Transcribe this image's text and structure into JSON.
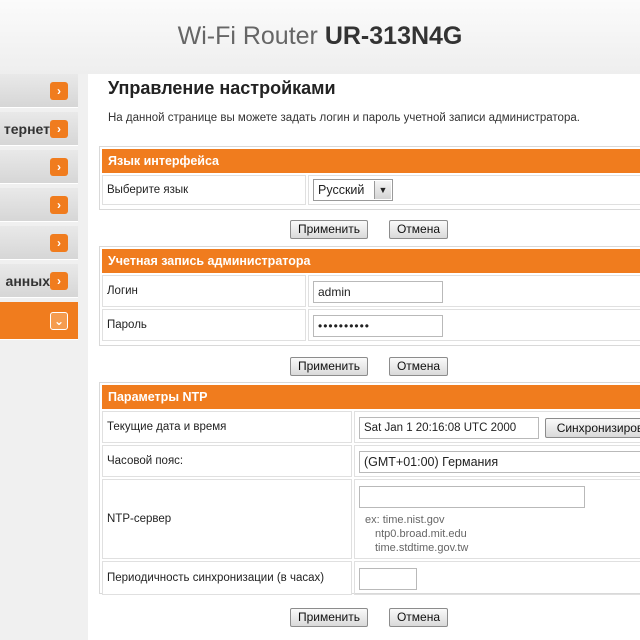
{
  "header": {
    "title_prefix": "Wi-Fi Router ",
    "model": "UR-313N4G"
  },
  "sidebar": {
    "items": [
      {
        "label": ""
      },
      {
        "label": "тернет"
      },
      {
        "label": ""
      },
      {
        "label": ""
      },
      {
        "label": ""
      },
      {
        "label": "анных"
      },
      {
        "label": ""
      }
    ]
  },
  "main": {
    "title": "Управление настройками",
    "description": "На данной странице вы можете задать логин и пароль учетной записи администратора."
  },
  "language_section": {
    "header": "Язык интерфейса",
    "select_label": "Выберите язык",
    "selected": "Русский"
  },
  "admin_section": {
    "header": "Учетная запись администратора",
    "login_label": "Логин",
    "login_value": "admin",
    "password_label": "Пароль",
    "password_value": "••••••••••"
  },
  "ntp_section": {
    "header": "Параметры NTP",
    "datetime_label": "Текущие дата и время",
    "datetime_value": "Sat Jan  1 20:16:08 UTC 2000",
    "sync_button": "Синхронизиров",
    "timezone_label": "Часовой пояс:",
    "timezone_value": "(GMT+01:00) Германия",
    "server_label": "NTP-сервер",
    "server_value": "",
    "server_hint_1": "ex: time.nist.gov",
    "server_hint_2": "ntp0.broad.mit.edu",
    "server_hint_3": "time.stdtime.gov.tw",
    "period_label": "Периодичность синхронизации (в часах)",
    "period_value": ""
  },
  "buttons": {
    "apply": "Применить",
    "cancel": "Отмена"
  },
  "colors": {
    "accent": "#f07c1e"
  },
  "icons": {
    "sidebar_arrow": "chevron-right-icon",
    "active_arrow": "chevron-down-icon",
    "select_arrow": "dropdown-arrow-icon"
  }
}
